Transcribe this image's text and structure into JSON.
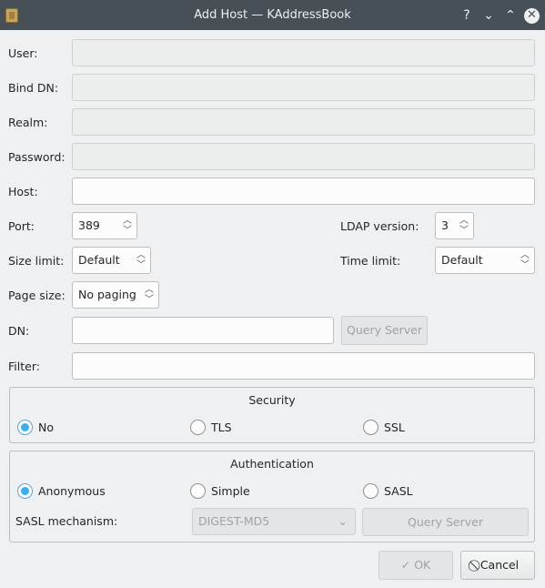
{
  "window": {
    "title": "Add Host — KAddressBook",
    "help_glyph": "?",
    "minimize_glyph": "⌄",
    "maximize_glyph": "⌃",
    "close_glyph": "✕"
  },
  "form": {
    "user_label": "User:",
    "bind_dn_label": "Bind DN:",
    "realm_label": "Realm:",
    "password_label": "Password:",
    "host_label": "Host:",
    "port_label": "Port:",
    "port_value": "389",
    "ldap_version_label": "LDAP version:",
    "ldap_version_value": "3",
    "size_limit_label": "Size limit:",
    "size_limit_value": "Default",
    "time_limit_label": "Time limit:",
    "time_limit_value": "Default",
    "page_size_label": "Page size:",
    "page_size_value": "No paging",
    "dn_label": "DN:",
    "query_server_label": "Query Server",
    "filter_label": "Filter:"
  },
  "security": {
    "title": "Security",
    "options": [
      "No",
      "TLS",
      "SSL"
    ],
    "selected": "No"
  },
  "authentication": {
    "title": "Authentication",
    "options": [
      "Anonymous",
      "Simple",
      "SASL"
    ],
    "selected": "Anonymous",
    "sasl_mechanism_label": "SASL mechanism:",
    "sasl_mechanism_value": "DIGEST-MD5",
    "query_server_label": "Query Server"
  },
  "buttons": {
    "ok_label": "OK",
    "cancel_label": "Cancel"
  },
  "icons": {
    "app": "kaddressbook-icon",
    "ok": "check-icon",
    "cancel": "cancel-icon"
  },
  "colors": {
    "titlebar": "#475057",
    "accent": "#3daee9",
    "background": "#eff0f1"
  }
}
